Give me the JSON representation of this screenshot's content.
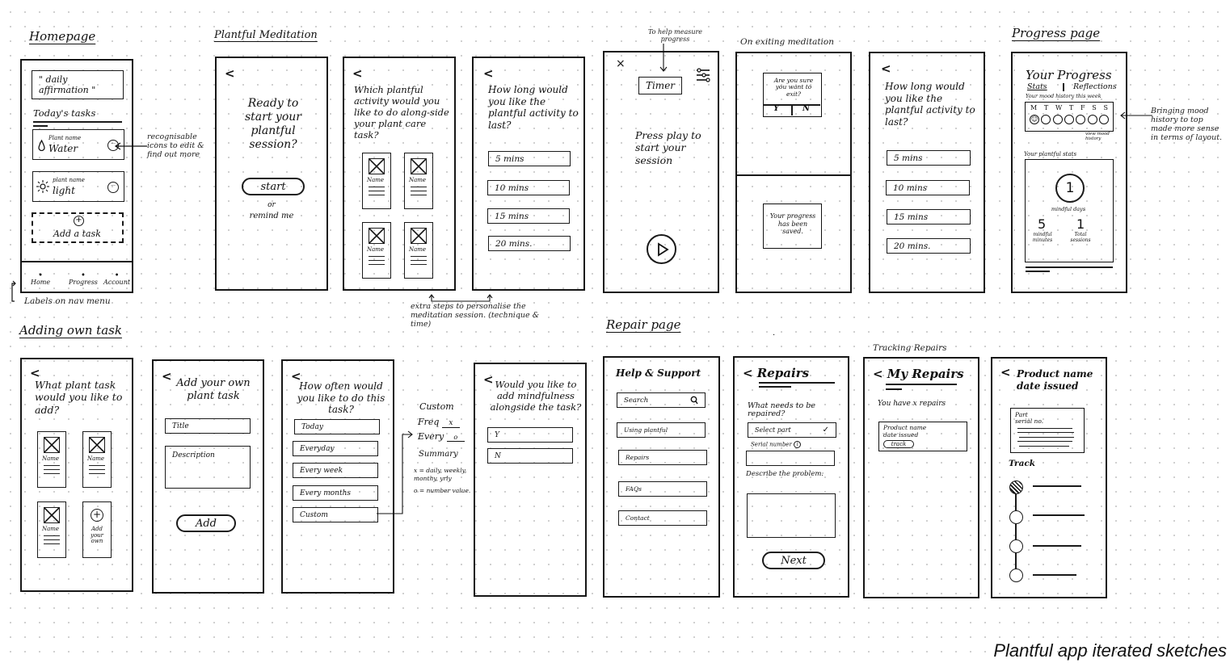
{
  "caption": "Plantful app iterated sketches",
  "sections": {
    "homepage": "Homepage",
    "meditation": "Plantful Meditation",
    "progress": "Progress page",
    "adding_task": "Adding own task",
    "repair": "Repair page",
    "tracking": "Tracking Repairs",
    "exiting": "On exiting meditation"
  },
  "homepage": {
    "affirmation": "\" daily affirmation \"",
    "todays_tasks": "Today's tasks",
    "tasks": [
      {
        "icon": "water-drop-icon",
        "plant": "Plant name",
        "action": "Water"
      },
      {
        "icon": "sun-icon",
        "plant": "plant name",
        "action": "light"
      }
    ],
    "add_task": "Add a task",
    "nav": [
      "Home",
      "Progress",
      "Account"
    ],
    "note_icons": "recognisable icons to edit & find out more",
    "note_nav": "Labels on nav menu"
  },
  "meditation": {
    "screen1": {
      "title": "Ready to start your plantful session?",
      "start": "start",
      "or": "or",
      "remind": "remind me"
    },
    "screen2": {
      "title": "Which plantful activity would you like to do along-side your plant care task?",
      "card_name": "Name"
    },
    "screen3": {
      "title": "How long would you like the plantful activity to last?",
      "options": [
        "5 mins",
        "10 mins",
        "15 mins",
        "20 mins."
      ]
    },
    "note_steps": "extra steps to personalise the meditation session. (technique & time)",
    "timer_note": "To help measure progress",
    "timer_label": "Timer",
    "press_play": "Press play to start your session",
    "exit_confirm": "Are you sure you want to exit?",
    "exit_yes": "Y",
    "exit_no": "N",
    "saved": "Your progress has been saved.",
    "screen7": {
      "title": "How long would you like the plantful activity to last?",
      "options": [
        "5 mins",
        "10 mins",
        "15 mins",
        "20 mins."
      ]
    }
  },
  "progress": {
    "title": "Your Progress",
    "tab_stats": "Stats",
    "tab_reflections": "Reflections",
    "mood_label": "Your mood history this week",
    "days": [
      "M",
      "T",
      "W",
      "T",
      "F",
      "S",
      "S"
    ],
    "view_mood": "view mood history",
    "stats_label": "Your plantful stats",
    "mindful_days_value": "1",
    "mindful_days_label": "mindful days",
    "mindful_minutes_value": "5",
    "mindful_minutes_label": "mindful minutes",
    "total_sessions_value": "1",
    "total_sessions_label": "Total sessions",
    "note": "Bringing mood history to top made more sense in terms of layout."
  },
  "adding": {
    "screen1": {
      "title": "What plant task would you like to add?",
      "card_name": "Name",
      "add_own": "Add your own"
    },
    "screen2": {
      "title": "Add your own plant task",
      "title_placeholder": "Title",
      "description_placeholder": "Description",
      "add": "Add"
    },
    "screen3": {
      "title": "How often would you like to do this task?",
      "options": [
        "Today",
        "Everyday",
        "Every week",
        "Every months",
        "Custom"
      ]
    },
    "custom": {
      "heading": "Custom",
      "freq": "Freq",
      "freq_val": "x",
      "every": "Every",
      "every_val": "o",
      "summary": "Summary",
      "legend_x": "x = daily, weekly, monthy, yrly",
      "legend_o": "o = number value."
    },
    "screen4": {
      "title": "Would you like to add mindfulness alongside the task?",
      "options": [
        "Y",
        "N"
      ]
    }
  },
  "repair": {
    "help": {
      "title": "Help & Support",
      "search": "Search",
      "items": [
        "Using plantful",
        "Repairs",
        "FAQs",
        "Contact"
      ]
    },
    "repairs": {
      "title": "< Repairs",
      "question": "What needs to be repaired?",
      "select": "Select part",
      "serial": "Serial number",
      "describe": "Describe the problem:",
      "next": "Next"
    },
    "my_repairs": {
      "title": "< My Repairs",
      "count": "You have x repairs",
      "product": "Product name",
      "date": "date issued",
      "track": "track"
    },
    "detail": {
      "title": "Product name date issued",
      "part": "Part",
      "serial": "serial no.",
      "track": "Track"
    }
  }
}
